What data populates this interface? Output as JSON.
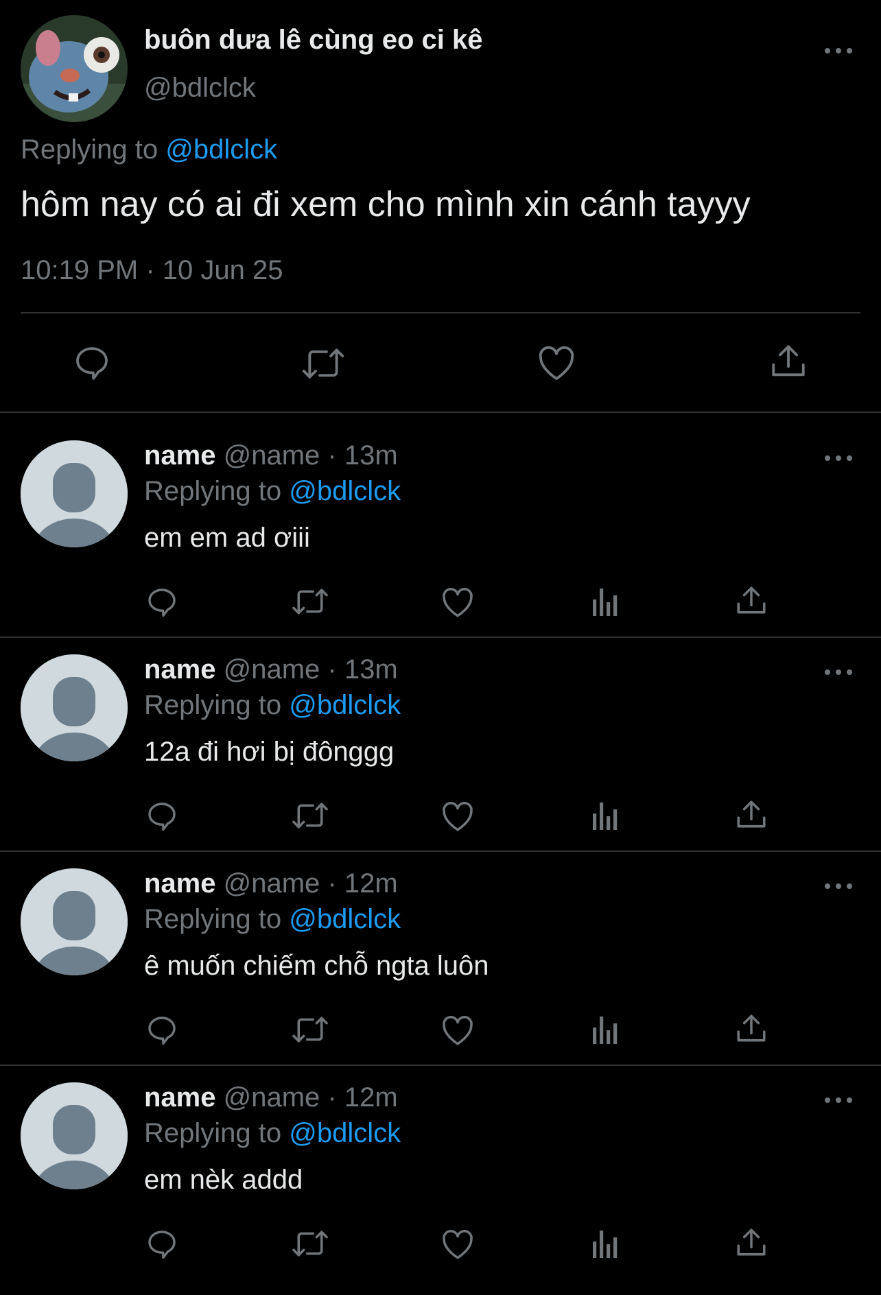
{
  "main_tweet": {
    "display_name": "buôn dưa lê cùng eo ci kê",
    "handle": "@bdlclck",
    "replying_prefix": "Replying to",
    "replying_to": "@bdlclck",
    "text": "hôm nay có ai đi xem cho mình xin cánh tayyy",
    "timestamp": "10:19 PM · 10 Jun 25"
  },
  "replies": [
    {
      "name": "name",
      "meta": "@name · 13m",
      "replying_prefix": "Replying to",
      "replying_to": "@bdlclck",
      "text": "em em ad ơiii"
    },
    {
      "name": "name",
      "meta": "@name · 13m",
      "replying_prefix": "Replying to",
      "replying_to": "@bdlclck",
      "text": "12a đi hơi bị đônggg"
    },
    {
      "name": "name",
      "meta": "@name · 12m",
      "replying_prefix": "Replying to",
      "replying_to": "@bdlclck",
      "text": "ê muốn chiếm chỗ ngta luôn"
    },
    {
      "name": "name",
      "meta": "@name · 12m",
      "replying_prefix": "Replying to",
      "replying_to": "@bdlclck",
      "text": "em nèk addd"
    }
  ],
  "icons": {
    "reply": "reply-icon",
    "retweet": "retweet-icon",
    "like": "heart-icon",
    "views": "views-icon",
    "share": "share-icon",
    "more": "more-icon"
  },
  "colors": {
    "background": "#000000",
    "text": "#e7e9ea",
    "muted": "#71767b",
    "accent": "#1d9bf0",
    "divider": "#2f3336"
  }
}
